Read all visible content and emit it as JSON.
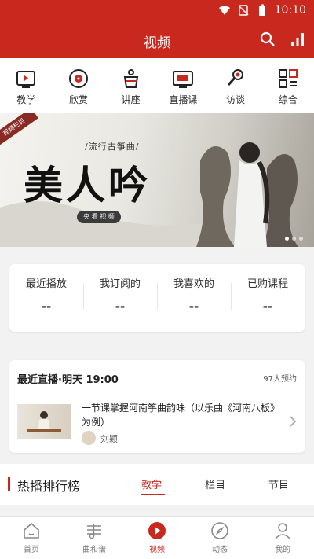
{
  "status_bar": {
    "time": "10:10"
  },
  "app_bar": {
    "title": "视频"
  },
  "categories": [
    {
      "label": "教学",
      "icon": "tv-play-icon"
    },
    {
      "label": "欣赏",
      "icon": "disc-icon"
    },
    {
      "label": "讲座",
      "icon": "podium-icon"
    },
    {
      "label": "直播课",
      "icon": "live-tv-icon"
    },
    {
      "label": "访谈",
      "icon": "microphone-icon"
    },
    {
      "label": "综合",
      "icon": "grid-icon"
    }
  ],
  "banner": {
    "corner_tag": "视频栏目",
    "subtitle": "/流行古筝曲/",
    "title": "美人吟",
    "pill_label": "央 看 视 频"
  },
  "stats": [
    {
      "label": "最近播放",
      "value": "--"
    },
    {
      "label": "我订阅的",
      "value": "--"
    },
    {
      "label": "我喜欢的",
      "value": "--"
    },
    {
      "label": "已购课程",
      "value": "--"
    }
  ],
  "live": {
    "heading": "最近直播·明天 19:00",
    "count": "97人预约",
    "course_title": "一节课掌握河南筝曲韵味（以乐曲《河南八板》为例）",
    "teacher": "刘颖"
  },
  "ranking": {
    "title": "热播排行榜",
    "tabs": [
      "教学",
      "栏目",
      "节目"
    ]
  },
  "tab_bar": [
    {
      "label": "首页",
      "icon": "home-icon"
    },
    {
      "label": "曲和谱",
      "icon": "music-score-icon"
    },
    {
      "label": "视频",
      "icon": "video-play-icon"
    },
    {
      "label": "动态",
      "icon": "compass-icon"
    },
    {
      "label": "我的",
      "icon": "profile-icon"
    }
  ],
  "colors": {
    "brand": "#c8281e"
  }
}
